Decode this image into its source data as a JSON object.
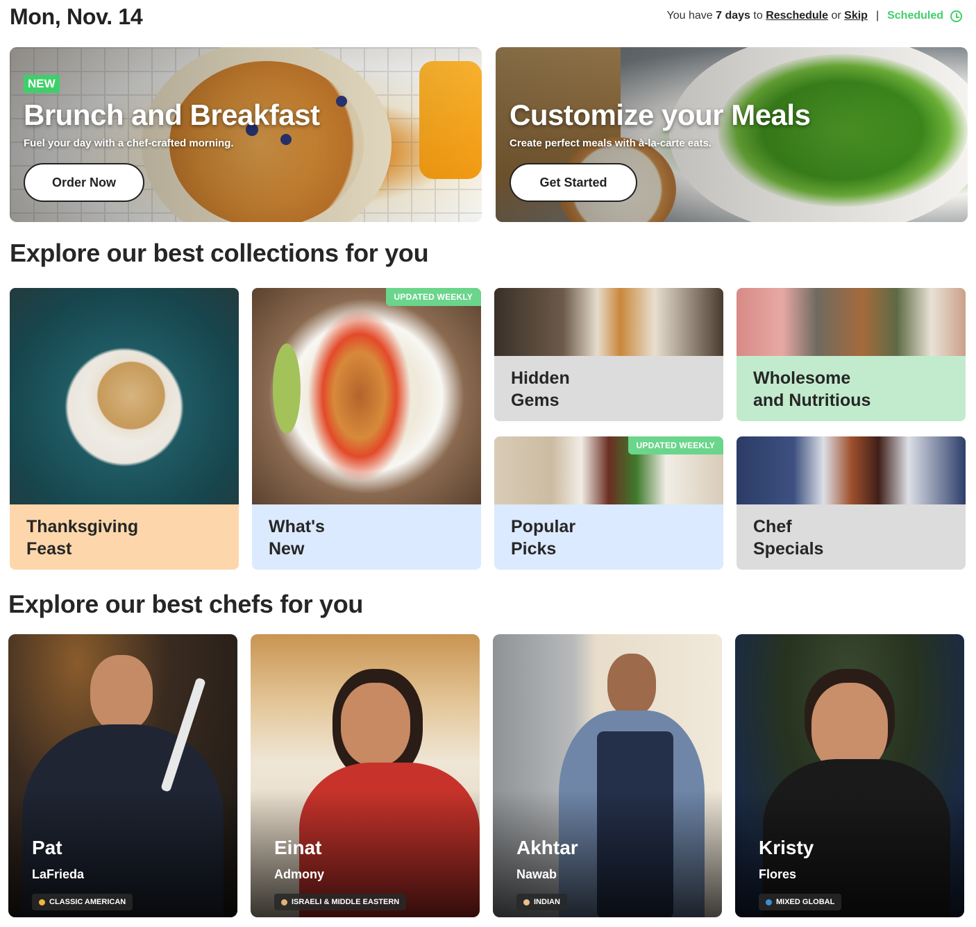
{
  "header": {
    "date": "Mon, Nov. 14",
    "notice_prefix": "You have",
    "notice_days": "7 days",
    "notice_to": "to",
    "reschedule_label": "Reschedule",
    "notice_or": "or",
    "skip_label": "Skip",
    "separator": "|",
    "status_label": "Scheduled",
    "status_color": "#3fcf6a"
  },
  "heroes": [
    {
      "badge": "NEW",
      "title": "Brunch and Breakfast",
      "subtitle": "Fuel your day with a chef-crafted morning.",
      "button": "Order Now"
    },
    {
      "title": "Customize your Meals",
      "subtitle": "Create perfect meals with à-la-carte eats.",
      "button": "Get Started"
    }
  ],
  "collections_section": {
    "title": "Explore our best collections for you",
    "items": [
      {
        "line1": "Thanksgiving",
        "line2": "Feast",
        "color": "#fdd7ab"
      },
      {
        "line1": "What's",
        "line2": "New",
        "color": "#dbeafe",
        "badge": "UPDATED WEEKLY"
      },
      {
        "line1": "Hidden",
        "line2": "Gems",
        "color": "#dcdcdc"
      },
      {
        "line1": "Wholesome",
        "line2": "and Nutritious",
        "color": "#c2ebcd"
      },
      {
        "line1": "Popular",
        "line2": "Picks",
        "color": "#dbeafe",
        "badge": "UPDATED WEEKLY"
      },
      {
        "line1": "Chef",
        "line2": "Specials",
        "color": "#dcdcdc"
      }
    ]
  },
  "chefs_section": {
    "title": "Explore our best chefs for you",
    "items": [
      {
        "first": "Pat",
        "last": "LaFrieda",
        "cuisine": "CLASSIC AMERICAN",
        "icon": "burger-icon"
      },
      {
        "first": "Einat",
        "last": "Admony",
        "cuisine": "ISRAELI & MIDDLE EASTERN",
        "icon": "pita-icon"
      },
      {
        "first": "Akhtar",
        "last": "Nawab",
        "cuisine": "INDIAN",
        "icon": "bread-icon"
      },
      {
        "first": "Kristy",
        "last": "Flores",
        "cuisine": "MIXED GLOBAL",
        "icon": "globe-icon"
      }
    ]
  }
}
